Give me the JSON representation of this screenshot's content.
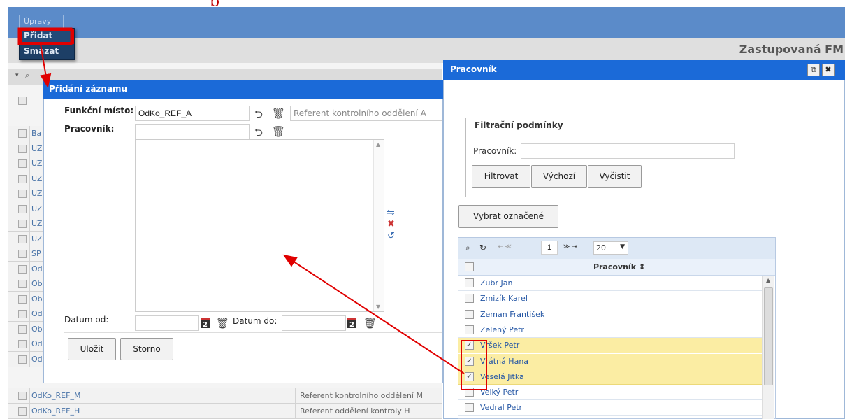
{
  "menu": {
    "top_label": "Úpravy",
    "items": [
      "Přidat",
      "Smazat"
    ]
  },
  "header": {
    "title": "Zastupovaná FM"
  },
  "bg_table": {
    "rows": [
      "Ba",
      "UZ",
      "UZ",
      "UZ",
      "UZ",
      "UZ",
      "UZ",
      "UZ",
      "SP",
      "Od",
      "Ob",
      "Ob",
      "Od",
      "Ob",
      "Od",
      "Od"
    ],
    "bottom_rows": [
      {
        "code": "OdKo_REF_M",
        "name": "Referent kontrolního oddělení M"
      },
      {
        "code": "OdKo_REF_H",
        "name": "Referent oddělení kontroly H"
      }
    ]
  },
  "add_dialog": {
    "title": "Přidání záznamu",
    "funkcni_misto_label": "Funkční místo:",
    "funkcni_misto_value": "OdKo_REF_A",
    "funkcni_misto_desc": "Referent kontrolního oddělení A",
    "pracovnik_label": "Pracovník:",
    "datum_od_label": "Datum od:",
    "datum_do_label": "Datum do:",
    "calendar_icon_text": "2",
    "save_label": "Uložit",
    "cancel_label": "Storno"
  },
  "pracovnik_window": {
    "title": "Pracovník",
    "filter_legend": "Filtrační podmínky",
    "filter_label": "Pracovník:",
    "filter_value": "",
    "btn_filter": "Filtrovat",
    "btn_default": "Výchozí",
    "btn_clear": "Vyčistit",
    "btn_select": "Vybrat označené",
    "pager_page": "1",
    "pager_size": "20",
    "column_header": "Pracovník ⇕",
    "rows": [
      {
        "name": "Zubr Jan",
        "checked": false
      },
      {
        "name": "Zmizík Karel",
        "checked": false
      },
      {
        "name": "Zeman František",
        "checked": false
      },
      {
        "name": "Zelený Petr",
        "checked": false
      },
      {
        "name": "Vršek Petr",
        "checked": true
      },
      {
        "name": "Vrátná Hana",
        "checked": true
      },
      {
        "name": "Veselá Jitka",
        "checked": true
      },
      {
        "name": "Velký Petr",
        "checked": false
      },
      {
        "name": "Vedral Petr",
        "checked": false
      }
    ]
  },
  "colors": {
    "header_blue": "#1b6ad8",
    "highlight_row": "#fbeda3",
    "annotation_red": "#e00000"
  }
}
